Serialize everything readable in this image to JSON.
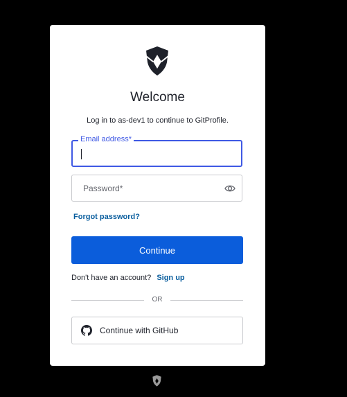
{
  "login": {
    "title": "Welcome",
    "subtitle": "Log in to as-dev1 to continue to GitProfile.",
    "email": {
      "label": "Email address*",
      "value": ""
    },
    "password": {
      "placeholder": "Password*"
    },
    "forgot_password": "Forgot password?",
    "continue_label": "Continue",
    "no_account_text": "Don't have an account?",
    "signup_label": "Sign up",
    "divider_text": "OR",
    "github_label": "Continue with GitHub"
  },
  "icons": {
    "logo": "shield-logo-icon",
    "password_toggle": "eye-icon",
    "github": "github-icon",
    "footer": "shield-logo-icon"
  },
  "colors": {
    "primary_button": "#0b5ddb",
    "focus_border": "#3f59e4",
    "link": "#0a5e9e",
    "background": "#000000",
    "card": "#ffffff"
  }
}
